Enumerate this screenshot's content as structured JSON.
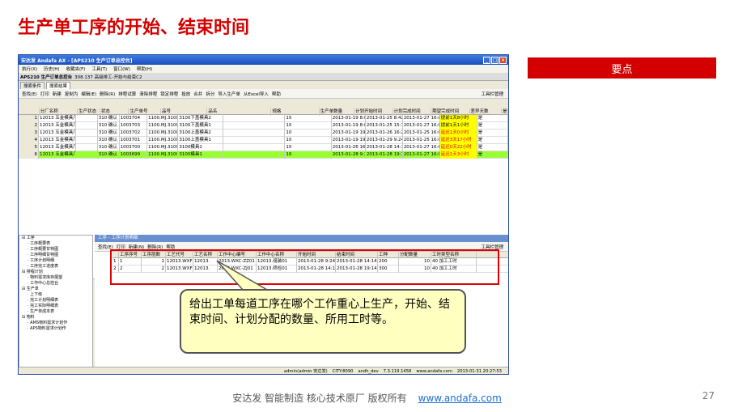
{
  "slide": {
    "title": "生产单工序的开始、结束时间",
    "keypoint": "要点",
    "callout": "给出工单每道工序在哪个工作重心上生产，开始、结束时间、计划分配的数量、所用工时等。",
    "footer_text": "安达发 智能制造 核心技术原厂 版权所有",
    "footer_link": "www.andafa.com",
    "page": "27"
  },
  "window": {
    "title": "安达发 Andafa AX - [APS210 生产订单总控台]",
    "menu": [
      "执行(X)",
      "历史(H)",
      "收藏夹(F)",
      "工具(T)",
      "窗口(W)",
      "帮助(H)"
    ],
    "subtitle": "APS210 生产订单总控台",
    "subtab": "308.137 高级排工-开始与结束C2",
    "tabs": [
      "搜索条件",
      "搜索结果"
    ],
    "toolbar": [
      "查找(E)",
      "打印",
      "新建",
      "复制为",
      "编辑(E)",
      "删除(R)",
      "排程试算",
      "清除排程",
      "锁定排程",
      "投放",
      "合并",
      "拆分",
      "导入生产单",
      "从Excel导入",
      "帮助"
    ],
    "toolbar_right": "工具栏管理",
    "headers": [
      "分厂名称",
      "生产状态",
      "状态",
      "生产单号",
      "品号",
      "品名",
      "规格",
      "生产单数量",
      "计划开始时间",
      "计划完成时间",
      "期望完成时间",
      "差异天数",
      "是"
    ],
    "rows": [
      [
        "1",
        "12013 五金模具厂",
        "310 确认",
        "1003704",
        "1100.MJ.3100.02-2",
        "3100下盖模具2",
        "",
        "10",
        "2013-01-19 8:00",
        "2013-01-25 8:42",
        "2013-01-27 16:00",
        "提前1天8小时",
        "是"
      ],
      [
        "2",
        "12013 五金模具厂",
        "310 确认",
        "1003703",
        "1100.MJ.3100.02-1",
        "3100下盖模具1",
        "",
        "10",
        "2013-01-19 8:00",
        "2013-01-25 15:12",
        "2013-01-27 16:00",
        "提前1天1小时",
        "是"
      ],
      [
        "3",
        "12013 五金模具厂",
        "310 确认",
        "1003702",
        "1100.MJ.3100.01-2",
        "3100上盖模具2",
        "",
        "10",
        "2013-01-19 19:30",
        "2013-01-26 16:23",
        "2013-01-25 16:00",
        "延迟1天0小时",
        "是"
      ],
      [
        "4",
        "12013 五金模具厂",
        "310 确认",
        "1003701",
        "1100.MJ.3100.01-1",
        "3100上盖模具1",
        "",
        "10",
        "2013-01-19 19:30",
        "2013-01-29 9:24",
        "2013-01-25 16:00",
        "延迟3天17小时",
        "是"
      ],
      [
        "5",
        "12013 五金模具厂",
        "310 确认",
        "1003700",
        "1100.MJ.3100-02",
        "3100模具2",
        "",
        "10",
        "2013-01-26 16:23",
        "2013-01-28 14:14",
        "2013-01-27 16:00",
        "延迟0天22小时",
        "是"
      ],
      [
        "6",
        "12013 五金模具厂",
        "310 确认",
        "1003699",
        "1100.MJ.3100.00-1",
        "3100模具1",
        "",
        "10",
        "2013-01-28 9:24",
        "2013-01-28 19:14",
        "2013-01-27 16:00",
        "延迟1天3小时",
        "是"
      ]
    ],
    "section_title": "工序 - 工序计划明细",
    "tree": [
      "工序",
      "工序概要表",
      "工序概要甘特图",
      "工序明细甘特图",
      "工序计划明细",
      "工序完工进度表",
      "排程计划",
      "物料需求库存展望",
      "工作中心总控台",
      "生产单",
      "上下级",
      "完工计划明细表",
      "完工实际明细表",
      "生产单成本表",
      "物料",
      "AMS物料需求计划作",
      "APS物料需求计划作"
    ],
    "sub_toolbar": [
      "查找(E)",
      "打印",
      "新建(N)",
      "删除(R)",
      "帮助"
    ],
    "sub_toolbar_right": "工具栏管理",
    "sub_headers": [
      "工序序号",
      "工序层数",
      "工艺代号",
      "工艺名称",
      "工作中心编号",
      "工作中心名称",
      "开始时间",
      "结束时间",
      "工种",
      "分配数量",
      "工时类型名称"
    ],
    "sub_rows": [
      [
        "1",
        "1",
        "1",
        "12013.WXF-ZZ",
        "12013.",
        "2013.WXC-ZZ01",
        "12013.组装01",
        "2013-01-28 9:24",
        "2013-01-28 14:14",
        "200",
        "10",
        "40 加工工时"
      ],
      [
        "2",
        "2",
        "2",
        "12013.WXF-ZJ",
        "12013.",
        "2013.WXC-ZJ01",
        "12013.终检01",
        "2013-01-28 14:14",
        "2013-01-28 19:14",
        "300",
        "10",
        "40 加工工时"
      ]
    ],
    "status": [
      "admin(admin 安达发)",
      "CITY:8090",
      "andh_dev",
      "7.3.119.1458",
      "www.andafa.com",
      "2013-01-31 20:27:53"
    ]
  }
}
